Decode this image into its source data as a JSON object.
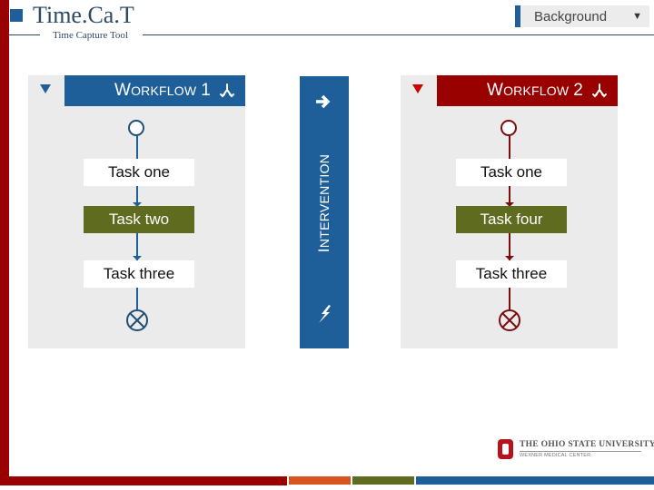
{
  "app": {
    "title": "Time.Ca.T",
    "subtitle": "Time Capture Tool"
  },
  "background_select": {
    "selected": "Background",
    "caret_icon": "triangle-down-icon"
  },
  "workflows": [
    {
      "title_first": "W",
      "title_rest": "ORKFLOW",
      "number": "1",
      "accent": "#1f5f99",
      "header_icon": "branch-icon",
      "tasks": [
        {
          "label": "Task one",
          "active": false
        },
        {
          "label": "Task two",
          "active": true
        },
        {
          "label": "Task three",
          "active": false
        }
      ]
    },
    {
      "title_first": "W",
      "title_rest": "ORKFLOW",
      "number": "2",
      "accent": "#990000",
      "header_icon": "branch-icon",
      "tasks": [
        {
          "label": "Task one",
          "active": false
        },
        {
          "label": "Task four",
          "active": true
        },
        {
          "label": "Task three",
          "active": false
        }
      ]
    }
  ],
  "intervention": {
    "label_first": "I",
    "label_rest": "NTERVENTION",
    "top_icon": "arrow-right-icon",
    "bottom_icon": "lightning-icon"
  },
  "footer_logo": {
    "university": "THE OHIO STATE UNIVERSITY",
    "center": "WEXNER MEDICAL CENTER"
  },
  "colors": {
    "scarlet": "#990000",
    "blue": "#1f5f99",
    "olive": "#5f6b1e",
    "orange": "#d9531e"
  }
}
